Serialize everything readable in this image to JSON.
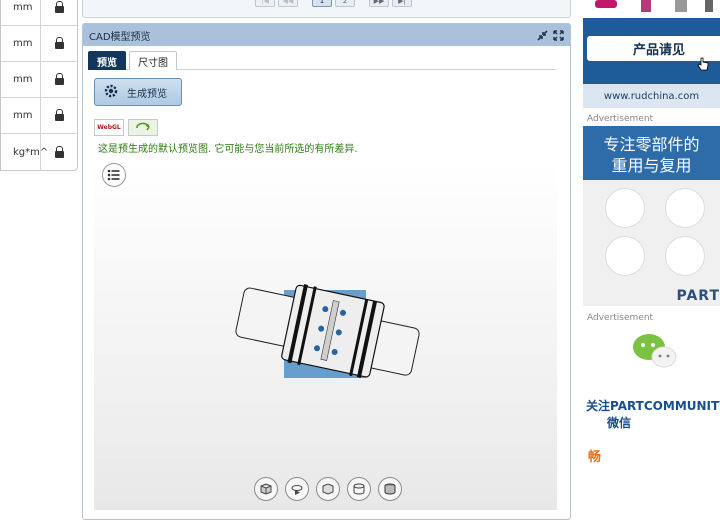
{
  "left_table": {
    "rows": [
      {
        "unit": "mm"
      },
      {
        "unit": "mm"
      },
      {
        "unit": "mm"
      },
      {
        "unit": "mm"
      },
      {
        "unit": "kg*m^"
      }
    ]
  },
  "pager": {
    "buttons": [
      "|◀",
      "◀◀",
      "1",
      "2",
      "▶▶",
      "▶|"
    ]
  },
  "cad": {
    "title": "CAD模型预览",
    "tabs": [
      "预览",
      "尺寸图"
    ],
    "generate_label": "生成预览",
    "webgl_label": "WebGL",
    "info_text": "这是预生成的默认预览图. 它可能与您当前所选的有所差异."
  },
  "right": {
    "product_button": "产品请见",
    "rud_url": "www.rudchina.com",
    "ad_label_1": "Advertisement",
    "ad_mid_line1": "专注零部件的",
    "ad_mid_line2": "重用与复用",
    "partsol": "PART",
    "ad_label_2": "Advertisement",
    "follow_line1": "关注PARTCOMMUNITY",
    "follow_line2": "微信",
    "orange": "畅"
  },
  "colors": {
    "header_blue": "#a9c2d9",
    "tab_active": "#13375c",
    "info_green": "#2d7a13",
    "ad_blue": "#1d5c98"
  }
}
